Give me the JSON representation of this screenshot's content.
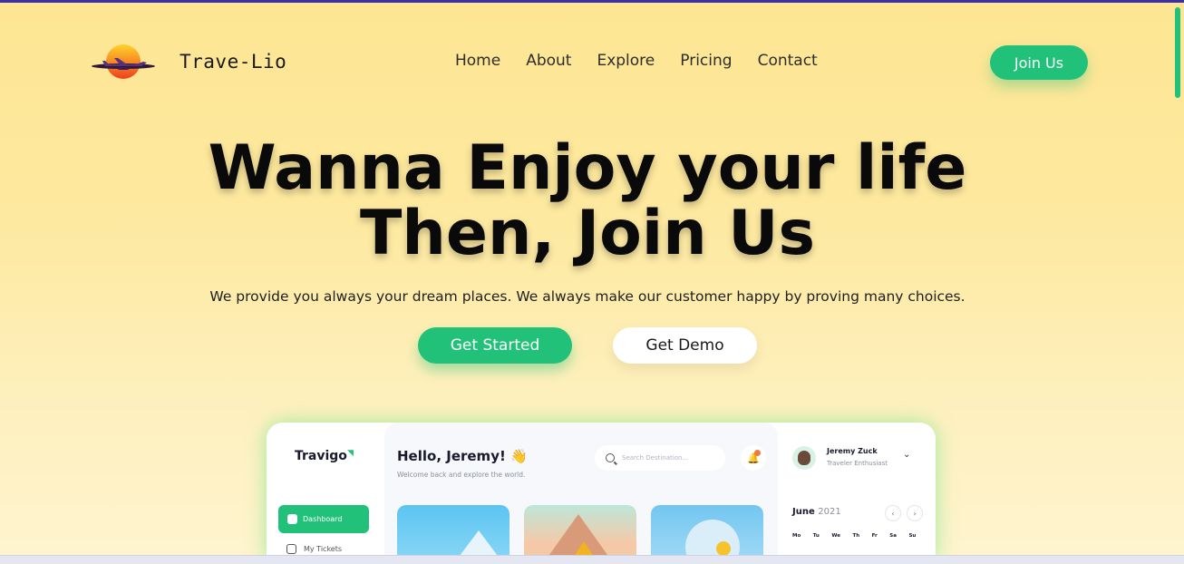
{
  "header": {
    "brand": "Trave-Lio",
    "nav": [
      "Home",
      "About",
      "Explore",
      "Pricing",
      "Contact"
    ],
    "join_label": "Join Us"
  },
  "hero": {
    "title_line1": "Wanna Enjoy your life",
    "title_line2": "Then, Join Us",
    "subtitle": "We provide you always your dream places. We always make our customer happy by proving many choices.",
    "cta_primary": "Get Started",
    "cta_secondary": "Get Demo"
  },
  "preview": {
    "brand": "Travigo",
    "sidebar": {
      "active": "Dashboard",
      "item2": "My Tickets"
    },
    "greeting": "Hello, Jeremy! 👋",
    "welcome": "Welcome back and explore the world.",
    "search_placeholder": "Search Destination...",
    "user": {
      "name": "Jeremy Zuck",
      "role": "Traveler Enthusiast"
    },
    "calendar": {
      "month": "June",
      "year": "2021",
      "days": [
        "Mo",
        "Tu",
        "We",
        "Th",
        "Fr",
        "Sa",
        "Su"
      ]
    }
  },
  "colors": {
    "accent": "#22c17a",
    "background": "#fde592",
    "text": "#0a0a0a",
    "top_border": "#3b2fa8"
  },
  "icons": [
    "airplane-sunset-logo",
    "search-icon",
    "bell-icon",
    "home-icon",
    "ticket-icon",
    "chevron-down-icon",
    "chevron-left-icon",
    "chevron-right-icon"
  ]
}
